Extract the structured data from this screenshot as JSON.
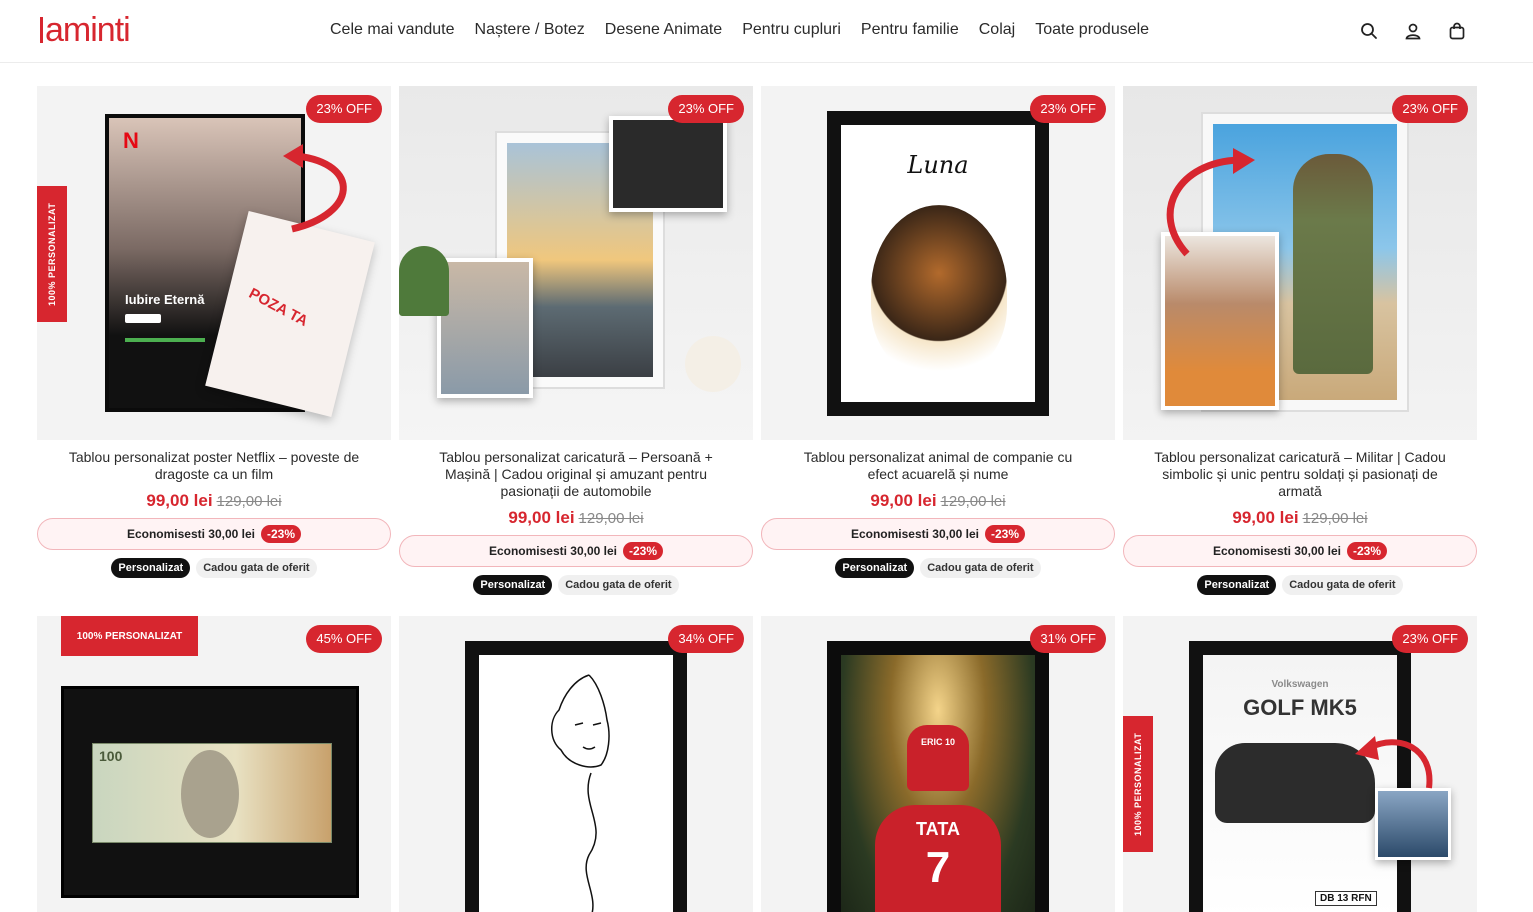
{
  "header": {
    "logo": "aminti",
    "nav": [
      "Cele mai vandute",
      "Nașt​ere / Botez",
      "Desene Animate",
      "Pentru cupluri",
      "Pentru familie",
      "Colaj",
      "Toate produsele"
    ],
    "icons": [
      "search-icon",
      "account-icon",
      "cart-icon"
    ]
  },
  "colors": {
    "accent": "#d7262f",
    "text": "#2b2b2b"
  },
  "products": [
    {
      "badge": "23% OFF",
      "title": "Tablou personalizat poster Netflix – poveste de dragoste ca un film",
      "price": "99,00 lei",
      "old_price": "129,00 lei",
      "save_text": "Economisesti 30,00 lei",
      "save_pct": "-23%",
      "tags": [
        "Personalizat",
        "Cadou gata de oferit"
      ],
      "art": {
        "ribbon": "100% PERSONALIZAT",
        "poster_title": "Iubire Eternă",
        "photo_label": "POZA TA"
      }
    },
    {
      "badge": "23% OFF",
      "title": "Tablou personalizat caricatură – Persoană + Mașină | Cadou original și amuzant pentru pasionații de automobile",
      "price": "99,00 lei",
      "old_price": "129,00 lei",
      "save_text": "Economisesti 30,00 lei",
      "save_pct": "-23%",
      "tags": [
        "Personalizat",
        "Cadou gata de oferit"
      ],
      "art": {}
    },
    {
      "badge": "23% OFF",
      "title": "Tablou personalizat animal de companie cu efect acuarelă și nume",
      "price": "99,00 lei",
      "old_price": "129,00 lei",
      "save_text": "Economisesti 30,00 lei",
      "save_pct": "-23%",
      "tags": [
        "Personalizat",
        "Cadou gata de oferit"
      ],
      "art": {
        "pet_name": "Luna"
      }
    },
    {
      "badge": "23% OFF",
      "title": "Tablou personalizat caricatură – Militar | Cadou simbolic și unic pentru soldați și pasionați de armată",
      "price": "99,00 lei",
      "old_price": "129,00 lei",
      "save_text": "Economisesti 30,00 lei",
      "save_pct": "-23%",
      "tags": [
        "Personalizat",
        "Cadou gata de oferit"
      ],
      "art": {}
    },
    {
      "badge": "45% OFF",
      "art": {
        "ribbon": "100% PERSONALIZAT",
        "note_value": "100"
      }
    },
    {
      "badge": "34% OFF",
      "art": {}
    },
    {
      "badge": "31% OFF",
      "art": {
        "jersey_small": "ERIC 10",
        "jersey_big": "TATA",
        "jersey_number": "7"
      }
    },
    {
      "badge": "23% OFF",
      "art": {
        "ribbon": "100% PERSONALIZAT",
        "brand": "Volkswagen",
        "model": "GOLF MK5",
        "plate": "DB 13 RFN"
      }
    }
  ]
}
